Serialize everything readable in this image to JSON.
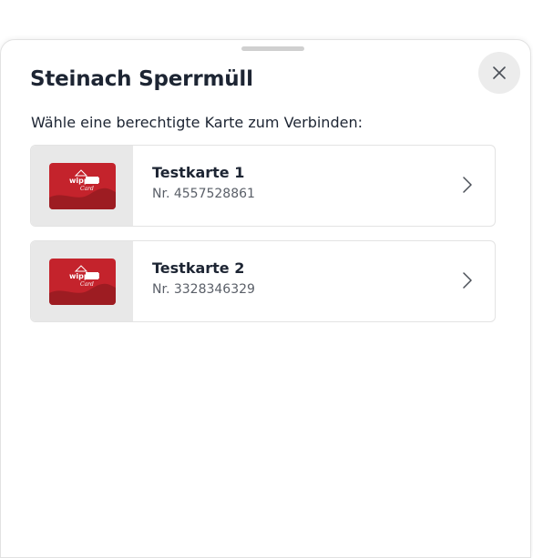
{
  "sheet": {
    "title": "Steinach Sperrmüll",
    "subtitle": "Wähle eine berechtigte Karte zum Verbinden:",
    "close_icon": "close-icon"
  },
  "cards": [
    {
      "name": "Testkarte 1",
      "number": "Nr. 4557528861",
      "logo_text": "wipptal",
      "logo_sub": "Card"
    },
    {
      "name": "Testkarte 2",
      "number": "Nr. 3328346329",
      "logo_text": "wipptal",
      "logo_sub": "Card"
    }
  ],
  "colors": {
    "card_red": "#c4232c",
    "card_dark_red": "#9d1c22",
    "text_dark": "#1d2533",
    "text_muted": "#5a5f68",
    "thumb_bg": "#e8e8e8"
  }
}
